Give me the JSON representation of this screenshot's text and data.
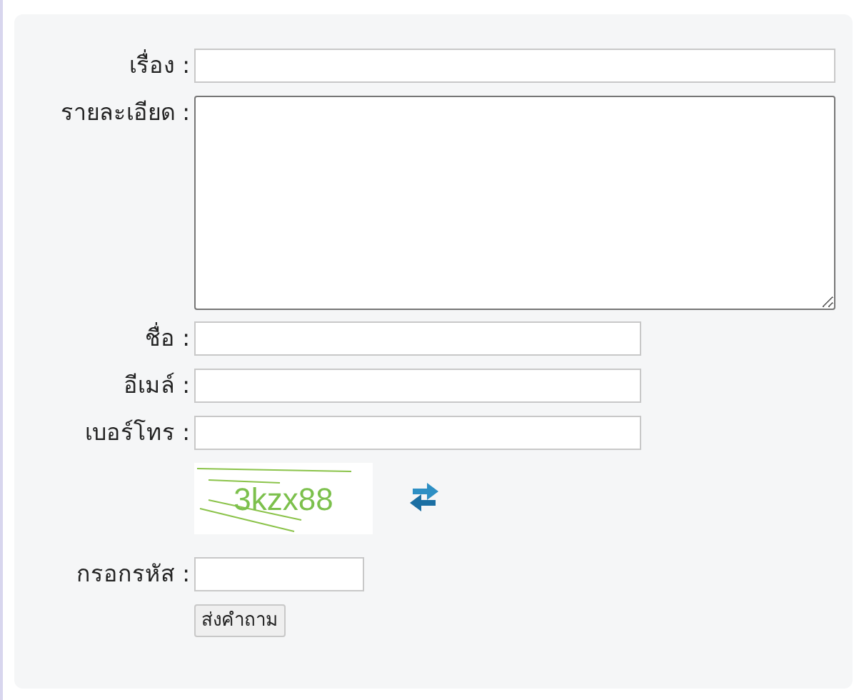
{
  "fields": [
    {
      "kind": "wide_text",
      "label": "เรื่อง :"
    },
    {
      "kind": "textarea",
      "label": "รายละเอียด :"
    },
    {
      "kind": "text",
      "label": "ชื่อ :"
    },
    {
      "kind": "text",
      "label": "อีเมล์ :"
    },
    {
      "kind": "text",
      "label": "เบอร์โทร :"
    }
  ],
  "captcha": {
    "code": "3kzx88"
  },
  "code_field": {
    "label": "กรอกรหัส :"
  },
  "submit": {
    "label": "ส่งคำถาม"
  }
}
